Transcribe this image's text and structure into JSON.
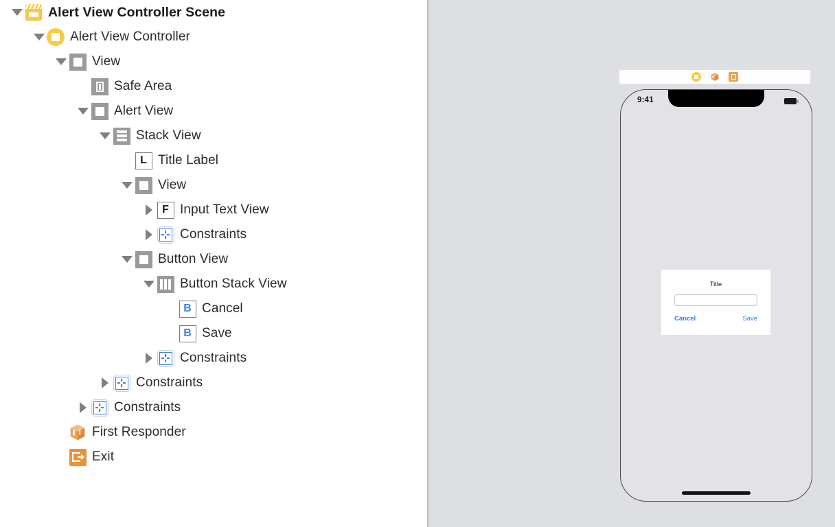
{
  "outline": {
    "rows": [
      {
        "label": "Alert View Controller Scene",
        "icon": "scene-clapperboard-icon",
        "disclosure": "down",
        "indent": 0,
        "bold": true
      },
      {
        "label": "Alert View Controller",
        "icon": "view-controller-icon",
        "disclosure": "down",
        "indent": 1,
        "bold": false
      },
      {
        "label": "View",
        "icon": "view-icon",
        "disclosure": "down",
        "indent": 2,
        "bold": false
      },
      {
        "label": "Safe Area",
        "icon": "safe-area-icon",
        "disclosure": "none",
        "indent": 3,
        "bold": false
      },
      {
        "label": "Alert View",
        "icon": "view-icon",
        "disclosure": "down",
        "indent": 3,
        "bold": false
      },
      {
        "label": "Stack View",
        "icon": "vertical-stack-view-icon",
        "disclosure": "down",
        "indent": 4,
        "bold": false
      },
      {
        "label": "Title Label",
        "icon": "label-icon",
        "disclosure": "none",
        "indent": 5,
        "bold": false
      },
      {
        "label": "View",
        "icon": "view-icon",
        "disclosure": "down",
        "indent": 5,
        "bold": false
      },
      {
        "label": "Input Text View",
        "icon": "text-field-icon",
        "disclosure": "right",
        "indent": 6,
        "bold": false
      },
      {
        "label": "Constraints",
        "icon": "constraints-icon",
        "disclosure": "right",
        "indent": 6,
        "bold": false
      },
      {
        "label": "Button View",
        "icon": "view-icon",
        "disclosure": "down",
        "indent": 5,
        "bold": false
      },
      {
        "label": "Button Stack View",
        "icon": "horizontal-stack-view-icon",
        "disclosure": "down",
        "indent": 6,
        "bold": false
      },
      {
        "label": "Cancel",
        "icon": "button-icon",
        "disclosure": "none",
        "indent": 7,
        "bold": false
      },
      {
        "label": "Save",
        "icon": "button-icon",
        "disclosure": "none",
        "indent": 7,
        "bold": false
      },
      {
        "label": "Constraints",
        "icon": "constraints-icon",
        "disclosure": "right",
        "indent": 6,
        "bold": false
      },
      {
        "label": "Constraints",
        "icon": "constraints-icon",
        "disclosure": "right",
        "indent": 4,
        "bold": false
      },
      {
        "label": "Constraints",
        "icon": "constraints-icon",
        "disclosure": "right",
        "indent": 3,
        "bold": false
      },
      {
        "label": "First Responder",
        "icon": "first-responder-icon",
        "disclosure": "none",
        "indent": 2,
        "bold": false
      },
      {
        "label": "Exit",
        "icon": "exit-icon",
        "disclosure": "none",
        "indent": 2,
        "bold": false
      }
    ]
  },
  "canvas": {
    "scene_dock": {
      "icons": [
        "view-controller-dock-icon",
        "first-responder-dock-icon",
        "exit-dock-icon"
      ]
    },
    "device": {
      "status_time": "9:41",
      "battery": "battery-icon",
      "screen_color": "#e3e3e7"
    },
    "alert": {
      "title": "Title",
      "input_value": "",
      "input_placeholder": "",
      "cancel_label": "Cancel",
      "save_label": "Save",
      "accent_color": "#2d7cf6"
    }
  }
}
